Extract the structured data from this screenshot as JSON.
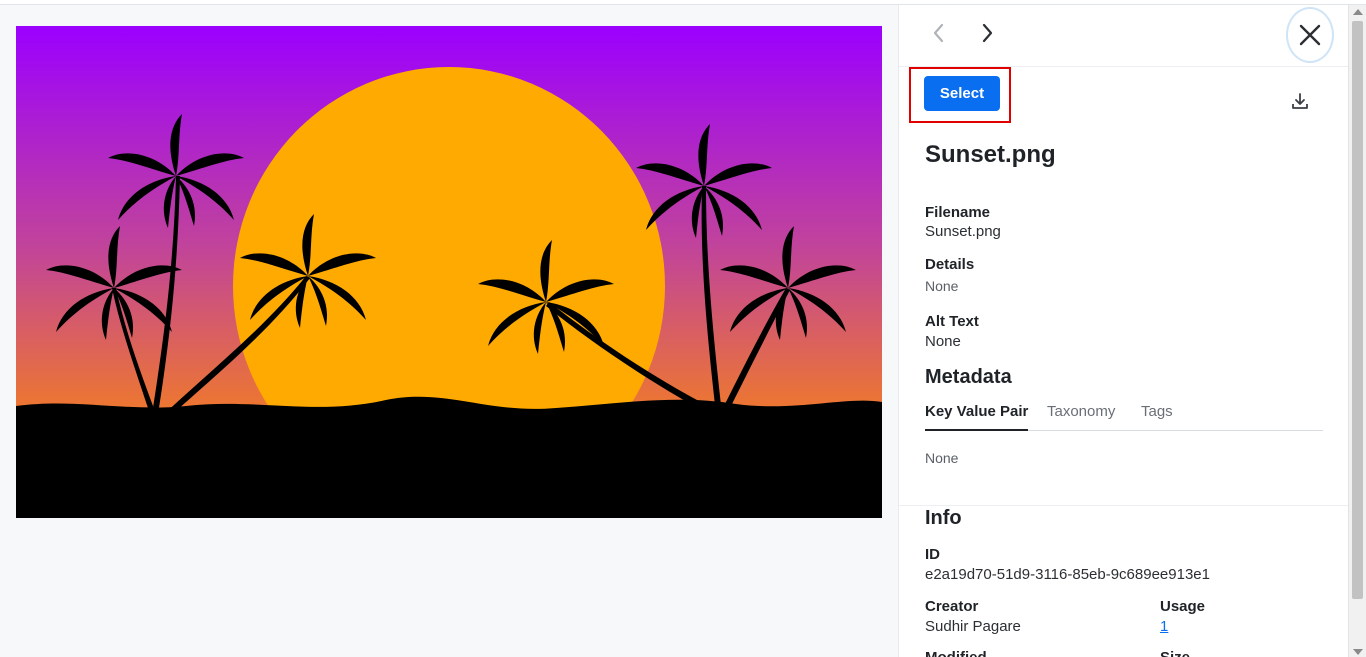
{
  "navigation": {
    "prev_icon": "chevron-left-icon",
    "next_icon": "chevron-right-icon",
    "close_icon": "close-icon"
  },
  "actions": {
    "select_label": "Select",
    "download_icon": "download-icon"
  },
  "asset": {
    "title": "Sunset.png",
    "filename_label": "Filename",
    "filename_value": "Sunset.png",
    "details_label": "Details",
    "details_value": "None",
    "alt_text_label": "Alt Text",
    "alt_text_value": "None"
  },
  "metadata": {
    "heading": "Metadata",
    "tabs": [
      {
        "label": "Key Value Pair",
        "active": true
      },
      {
        "label": "Taxonomy",
        "active": false
      },
      {
        "label": "Tags",
        "active": false
      }
    ],
    "content": "None"
  },
  "info": {
    "heading": "Info",
    "id_label": "ID",
    "id_value": "e2a19d70-51d9-3116-85eb-9c689ee913e1",
    "creator_label": "Creator",
    "creator_value": "Sudhir Pagare",
    "usage_label": "Usage",
    "usage_value": "1",
    "modified_label": "Modified",
    "size_label": "Size"
  },
  "colors": {
    "accent": "#0a6ef0",
    "highlight_frame": "#e00000",
    "sky_top": "#9b00ff",
    "sky_bottom": "#f07a2a",
    "sun": "#ffaa00",
    "silhouette": "#000000"
  }
}
